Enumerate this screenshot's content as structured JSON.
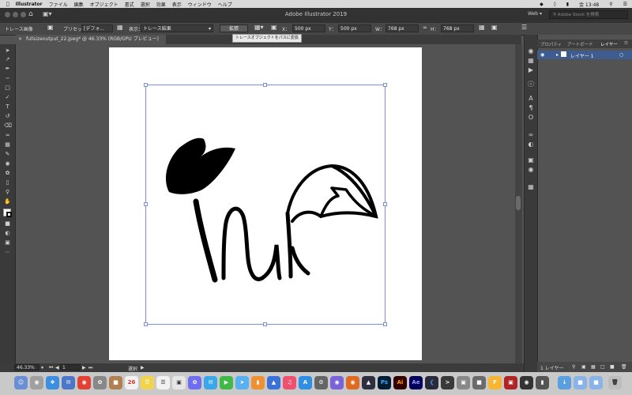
{
  "menubar": {
    "app_name": "Illustrator",
    "items": [
      "ファイル",
      "編集",
      "オブジェクト",
      "書式",
      "選択",
      "効果",
      "表示",
      "ウィンドウ",
      "ヘルプ"
    ],
    "clock": "金 13:48"
  },
  "appbar": {
    "title": "Adobe Illustrator 2019",
    "workspace": "Web",
    "search_placeholder": "Adobe Stock を検索"
  },
  "controlbar": {
    "trace_image": "トレース画像",
    "preset_label": "プリセット：",
    "preset_value": "[デフォ...",
    "view_label": "表示：",
    "view_value": "トレース結果",
    "expand_button": "拡張",
    "x_label": "X：",
    "x_value": "500 px",
    "y_label": "Y：",
    "y_value": "500 px",
    "w_label": "W：",
    "w_value": "768 px",
    "h_label": "H：",
    "h_value": "768 px"
  },
  "tooltip": "トレースオブジェクトをパスに変換",
  "document_tab": "fullsizeoutput_22.jpeg* @ 46.33% (RGB/GPU プレビュー)",
  "statusbar": {
    "zoom": "46.33%",
    "page": "1",
    "mode": "選択"
  },
  "layers_panel": {
    "tabs": [
      "プロパティ",
      "アートボード",
      "レイヤー"
    ],
    "active_tab": "レイヤー",
    "layer_name": "レイヤー 1",
    "footer": "1 レイヤー"
  },
  "colors": {
    "accent": "#3e5d8e",
    "selection": "#7d8fdc",
    "illustrator_orange": "#ff9a00",
    "illustrator_bg": "#330000"
  }
}
